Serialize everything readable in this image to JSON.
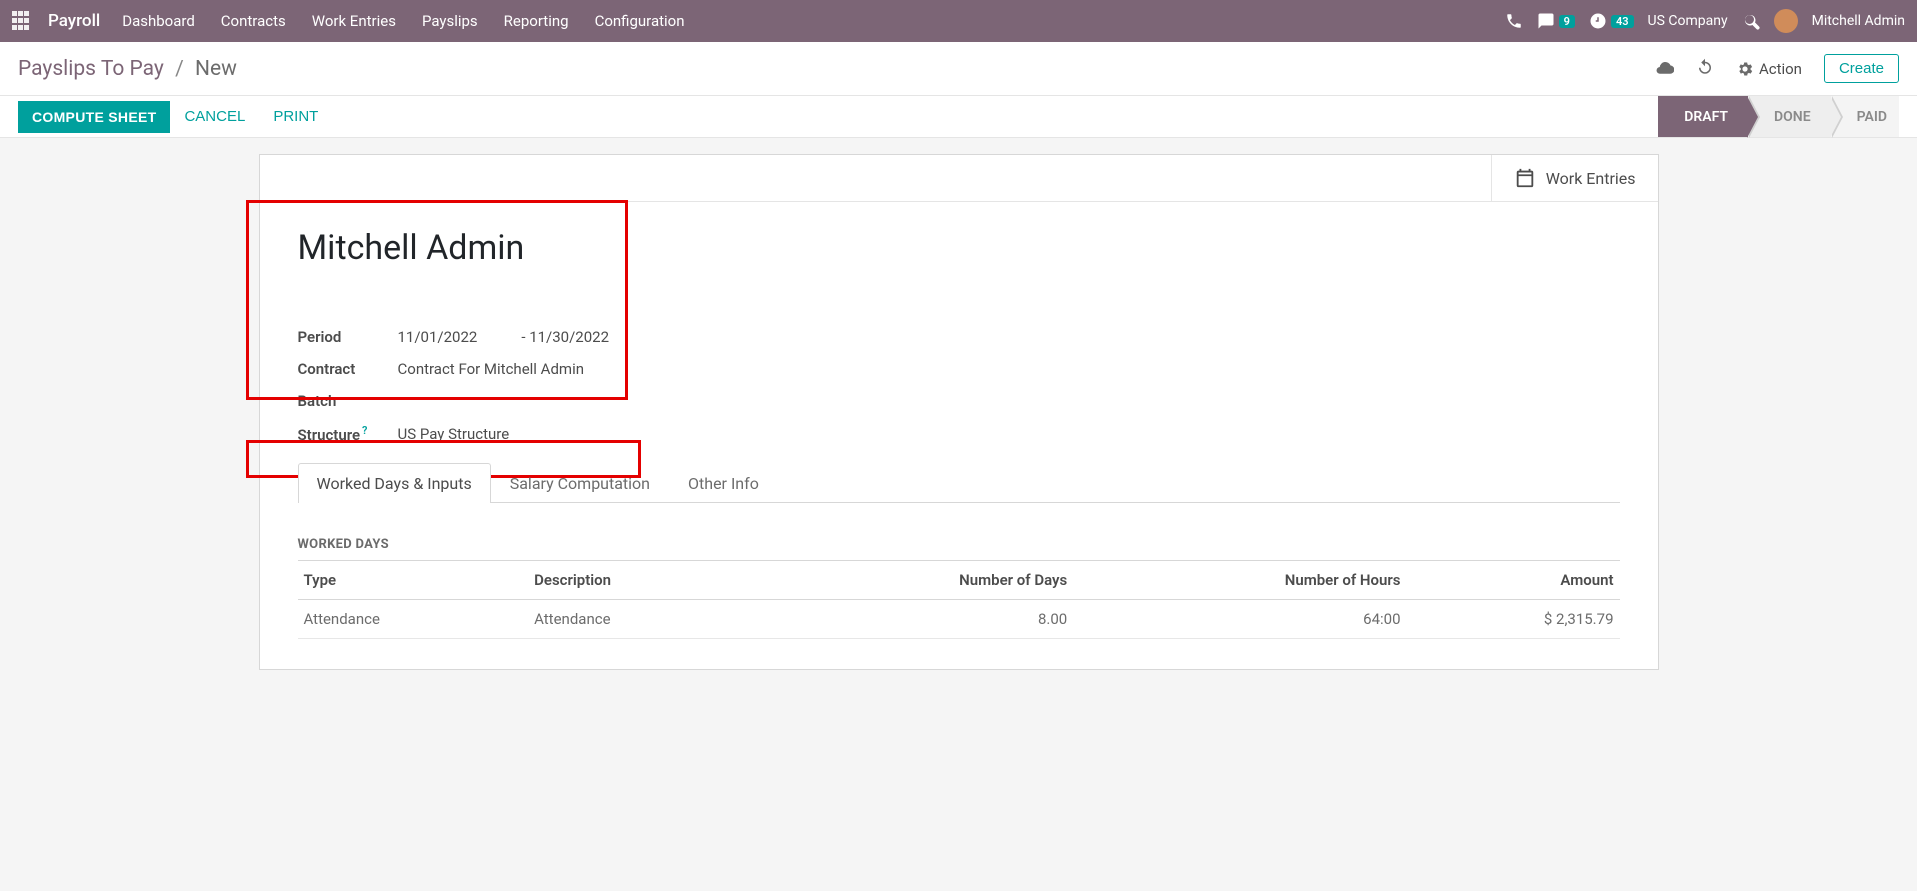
{
  "topnav": {
    "brand": "Payroll",
    "menu": [
      "Dashboard",
      "Contracts",
      "Work Entries",
      "Payslips",
      "Reporting",
      "Configuration"
    ],
    "chat_badge": "9",
    "clock_badge": "43",
    "company": "US Company",
    "user": "Mitchell Admin"
  },
  "crumb": {
    "parent": "Payslips To Pay",
    "current": "New",
    "action": "Action",
    "create": "Create"
  },
  "actions": {
    "compute": "COMPUTE SHEET",
    "cancel": "CANCEL",
    "print": "PRINT",
    "status": [
      "DRAFT",
      "DONE",
      "PAID"
    ]
  },
  "sheet": {
    "work_entries_btn": "Work Entries",
    "employee": "Mitchell Admin",
    "fields": {
      "period_label": "Period",
      "period_from": "11/01/2022",
      "period_to": "- 11/30/2022",
      "contract_label": "Contract",
      "contract": "Contract For Mitchell Admin",
      "batch_label": "Batch",
      "batch": "",
      "structure_label": "Structure",
      "structure_help": "?",
      "structure": "US Pay Structure"
    },
    "tabs": [
      "Worked Days & Inputs",
      "Salary Computation",
      "Other Info"
    ],
    "wd_title": "WORKED DAYS",
    "wd_cols": {
      "type": "Type",
      "desc": "Description",
      "days": "Number of Days",
      "hours": "Number of Hours",
      "amount": "Amount"
    },
    "wd_rows": [
      {
        "type": "Attendance",
        "desc": "Attendance",
        "days": "8.00",
        "hours": "64:00",
        "amount": "$ 2,315.79"
      }
    ]
  }
}
